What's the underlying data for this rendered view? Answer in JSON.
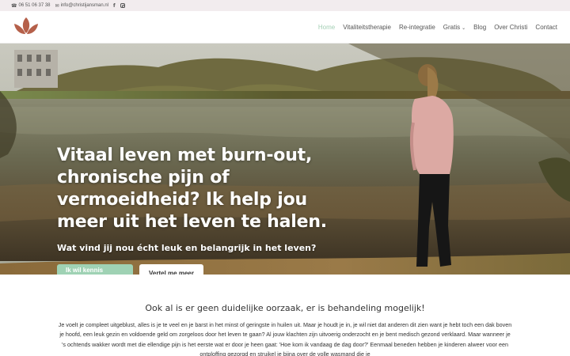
{
  "topbar": {
    "phone": "06 51 06 37 38",
    "email": "info@christijansman.nl"
  },
  "nav": {
    "items": [
      {
        "label": "Home"
      },
      {
        "label": "Vitaliteitstherapie"
      },
      {
        "label": "Re-integratie"
      },
      {
        "label": "Gratis"
      },
      {
        "label": "Blog"
      },
      {
        "label": "Over Christi"
      },
      {
        "label": "Contact"
      }
    ],
    "active_color": "#a3cfb4"
  },
  "hero": {
    "heading": "Vitaal leven met burn-out, chronische pijn of vermoeidheid? Ik help jou meer uit het leven te halen.",
    "subheading": "Wat vind jij nou écht leuk en belangrijk in het leven?",
    "primary_button": "Ik wil kennis maken",
    "secondary_button": "Vertel me meer"
  },
  "intro": {
    "title": "Ook al is er geen duidelijke oorzaak, er is behandeling mogelijk!",
    "body": "Je voelt je compleet uitgeblust, alles is je te veel en je barst in het minst of geringste in huilen uit. Maar je houdt je in, je wil niet dat anderen dit zien want je hebt toch een dak boven je hoofd, een leuk gezin en voldoende geld om zorgeloos door het leven te gaan? Al jouw klachten zijn uitvoerig onderzocht en je bent medisch gezond verklaard. Maar wanneer je 's ochtends wakker wordt met die ellendige pijn is het eerste wat er door je heen gaat: 'Hoe kom ik vandaag de dag door?' Eenmaal beneden hebben je kinderen alweer voor een ontploffing gezorgd en struikel je bijna over de volle wasmand die je"
  },
  "colors": {
    "accent": "#9fd2b4",
    "logo": "#b5604a",
    "topbar_bg": "#f2ecee"
  }
}
